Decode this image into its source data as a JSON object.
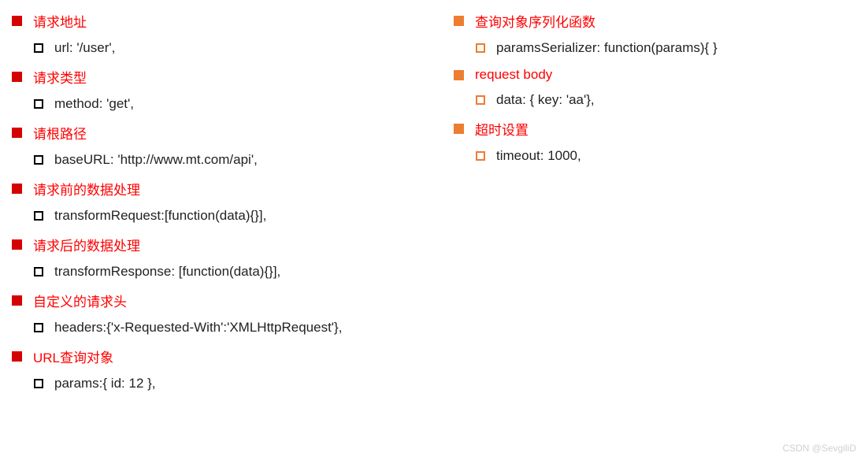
{
  "leftColumn": [
    {
      "heading": "请求地址",
      "sub": "url: '/user',"
    },
    {
      "heading": "请求类型",
      "sub": "method: 'get',"
    },
    {
      "heading": "请根路径",
      "sub": "baseURL: 'http://www.mt.com/api',"
    },
    {
      "heading": "请求前的数据处理",
      "sub": "transformRequest:[function(data){}],"
    },
    {
      "heading": "请求后的数据处理",
      "sub": "transformResponse: [function(data){}],"
    },
    {
      "heading": "自定义的请求头",
      "sub": "headers:{'x-Requested-With':'XMLHttpRequest'},"
    },
    {
      "heading": "URL查询对象",
      "sub": "params:{ id: 12 },"
    }
  ],
  "rightColumn": [
    {
      "heading": "查询对象序列化函数",
      "sub": "paramsSerializer: function(params){ }"
    },
    {
      "heading": "request body",
      "sub": "data: { key: 'aa'},"
    },
    {
      "heading": "超时设置",
      "sub": "timeout: 1000,"
    }
  ],
  "watermark": "CSDN @SevgiliD"
}
